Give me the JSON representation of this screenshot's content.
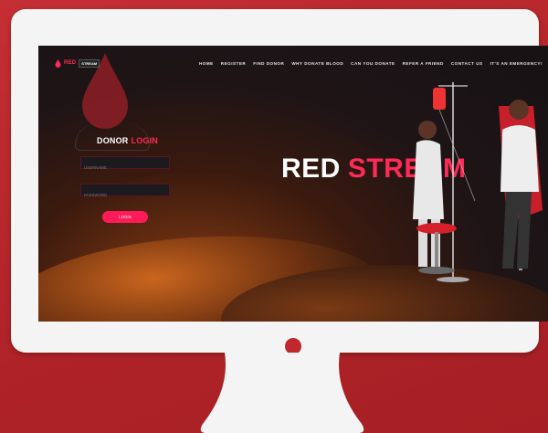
{
  "brand": {
    "red": "RED",
    "stream": "STREAM"
  },
  "nav": {
    "items": [
      "HOME",
      "REGISTER",
      "FIND DONOR",
      "WHY DONATE BLOOD",
      "CAN YOU DONATE",
      "REFER A FRIEND",
      "CONTACT US",
      "IT'S AN EMERGENCY!"
    ]
  },
  "login": {
    "title_white": "DONOR",
    "title_red": "LOGIN",
    "username_placeholder": "USERNAME",
    "password_placeholder": "PASSWORD",
    "button": "LOGIN"
  },
  "hero": {
    "white": "RED",
    "red": "STREAM"
  },
  "icons": [
    "blood-drop-icon",
    "hand-icon",
    "power-button-icon"
  ],
  "colors": {
    "accent": "#ff2a55",
    "background": "#b8262c",
    "monitor": "#f4f4f4"
  }
}
